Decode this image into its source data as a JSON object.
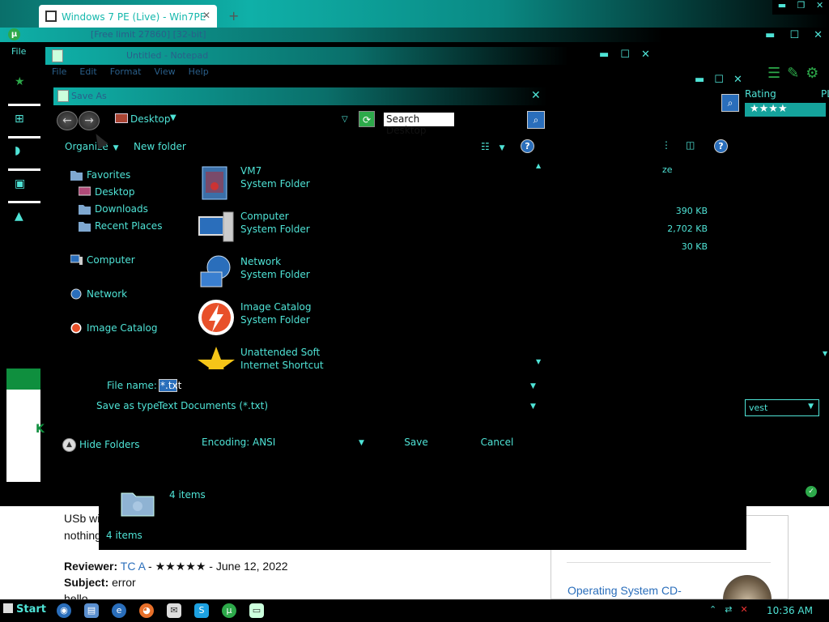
{
  "browser": {
    "tab_title": "Windows 7 PE (Live) - Win7PE",
    "tab_close": "✕",
    "new_tab": "+",
    "window_controls": [
      "▬",
      "❐",
      "✕"
    ]
  },
  "utorrent": {
    "title": "[Free limit 27860] [32-bit]",
    "controls": [
      "▬",
      "☐",
      "✕"
    ],
    "menu_fragment": "File",
    "headers": {
      "rating": "Rating",
      "pl": "PL",
      "size": "ze"
    },
    "stars": "★★★★",
    "sizes": [
      "390 KB",
      "2,702 KB",
      "30 KB"
    ],
    "harvest": "vest",
    "items_count_1": "4 items",
    "items_count_2": "4 items"
  },
  "notepad": {
    "title": "Untitled - Notepad",
    "menu": [
      "File",
      "Edit",
      "Format",
      "View",
      "Help"
    ],
    "controls": [
      "▬",
      "☐",
      "✕"
    ],
    "right_controls": [
      "▬",
      "☐",
      "✕"
    ]
  },
  "dialog": {
    "title": "Save As",
    "close": "✕",
    "address": "Desktop",
    "search_placeholder": "Search Desktop",
    "toolbar": {
      "organize": "Organize",
      "new_folder": "New folder"
    },
    "nav": {
      "favorites": "Favorites",
      "desktop": "Desktop",
      "downloads": "Downloads",
      "recent_places": "Recent Places",
      "computer": "Computer",
      "network": "Network",
      "image_catalog": "Image Catalog"
    },
    "files": [
      {
        "name": "VM7",
        "type": "System Folder"
      },
      {
        "name": "Computer",
        "type": "System Folder"
      },
      {
        "name": "Network",
        "type": "System Folder"
      },
      {
        "name": "Image Catalog",
        "type": "System Folder"
      },
      {
        "name": "Unattended Soft",
        "type": "Internet Shortcut"
      }
    ],
    "file_name_label": "File name:",
    "file_name_value": "*.txt",
    "save_type_label": "Save as type:",
    "save_type_value": "Text Documents (*.txt)",
    "hide_folders": "Hide Folders",
    "encoding_label": "Encoding:",
    "encoding_value": "ANSI",
    "save_button": "Save",
    "cancel_button": "Cancel"
  },
  "webpage": {
    "text1": "USb wi",
    "text2": "nothing",
    "reviewer_label": "Reviewer:",
    "reviewer_name": "TC A",
    "review_stars": "★★★★★",
    "review_date": "June 12, 2022",
    "subject_label": "Subject:",
    "subject_value": "error",
    "hello": "hello",
    "sidebar_link": "Operating System CD-"
  },
  "taskbar": {
    "start": "Start",
    "clock": "10:36 AM"
  },
  "colors": {
    "accent": "#4fe3d6",
    "title_gradient": "#0fb0a8",
    "link": "#2a6ebb",
    "green": "#2da94a"
  }
}
